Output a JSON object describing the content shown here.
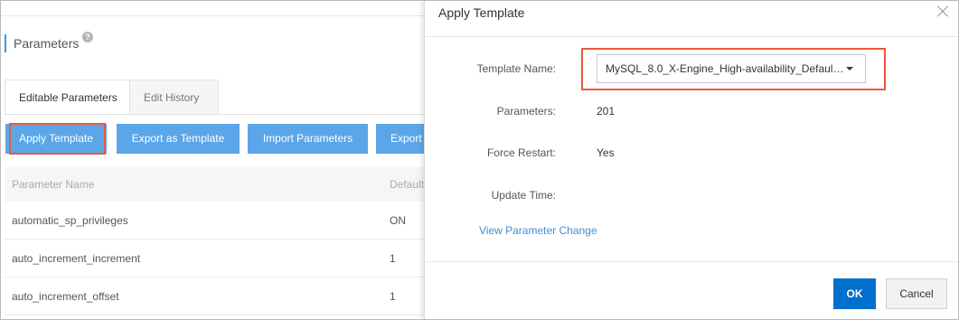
{
  "background": {
    "page_title": "Parameters",
    "help_icon": "?",
    "tabs": [
      {
        "label": "Editable Parameters",
        "active": true
      },
      {
        "label": "Edit History",
        "active": false
      }
    ],
    "toolbar": {
      "apply_template": "Apply Template",
      "export_as_template": "Export as Template",
      "import_parameters": "Import Parameters",
      "export": "Export"
    },
    "table": {
      "columns": [
        "Parameter Name",
        "Default"
      ],
      "rows": [
        {
          "name": "automatic_sp_privileges",
          "default": "ON"
        },
        {
          "name": "auto_increment_increment",
          "default": "1"
        },
        {
          "name": "auto_increment_offset",
          "default": "1"
        }
      ]
    }
  },
  "dialog": {
    "title": "Apply Template",
    "close_icon": "close-icon",
    "fields": {
      "template_name_label": "Template Name:",
      "template_name_value": "MySQL_8.0_X-Engine_High-availability_Default ...",
      "parameters_label": "Parameters:",
      "parameters_value": "201",
      "force_restart_label": "Force Restart:",
      "force_restart_value": "Yes",
      "update_time_label": "Update Time:",
      "update_time_value": ""
    },
    "view_change_link": "View Parameter Change",
    "ok_button": "OK",
    "cancel_button": "Cancel"
  },
  "colors": {
    "primary_button": "#5aa6e8",
    "ok_button": "#0070cc",
    "link": "#3a8fd8",
    "highlight": "#e85a3c",
    "title_accent": "#3d9be9"
  }
}
